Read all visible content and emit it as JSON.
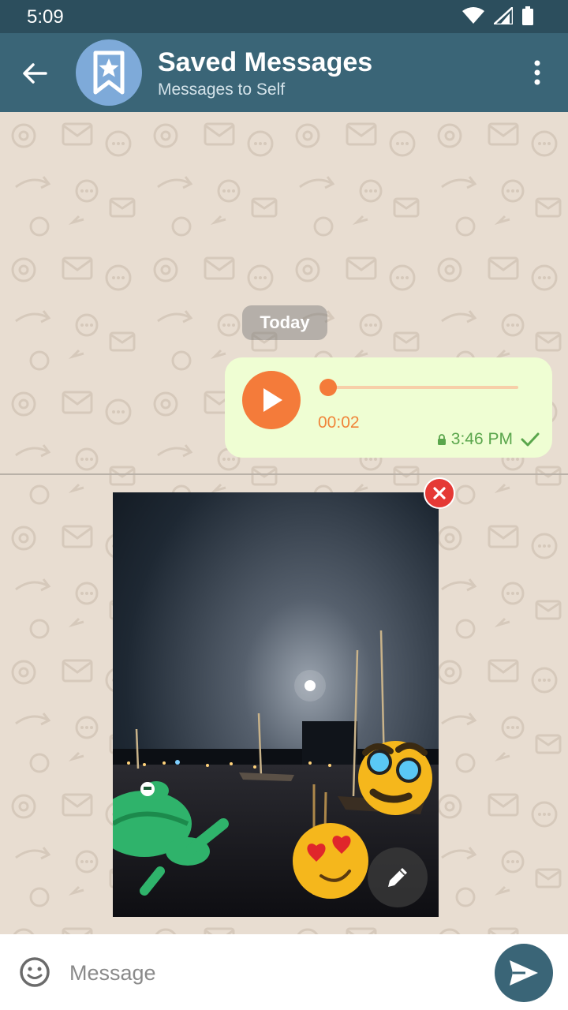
{
  "status_bar": {
    "time": "5:09",
    "icons": [
      "wifi-icon",
      "signal-icon",
      "battery-icon"
    ]
  },
  "header": {
    "title": "Saved Messages",
    "subtitle": "Messages to Self",
    "back_icon": "arrow-left-icon",
    "avatar_icon": "bookmark-star-icon",
    "menu_icon": "more-vertical-icon"
  },
  "chat": {
    "date_label": "Today",
    "voice_message": {
      "duration": "00:02",
      "time": "3:46 PM",
      "progress": 0.0,
      "status": "sent"
    }
  },
  "attachment_preview": {
    "remove_icon": "close-icon",
    "edit_icon": "pencil-icon",
    "stickers": [
      "frog-sticker",
      "disguise-face-sticker",
      "heart-eyes-sticker"
    ]
  },
  "composer": {
    "placeholder": "Message",
    "value": "",
    "emoji_icon": "smiley-icon",
    "send_icon": "send-icon"
  },
  "colors": {
    "app_bar": "#3a6577",
    "status_bar": "#2c4e5d",
    "accent_orange": "#f47b3a",
    "bubble_out": "#effed3",
    "chat_background": "#e8ddd1",
    "check_green": "#5aa64c",
    "remove_red": "#e53935"
  }
}
